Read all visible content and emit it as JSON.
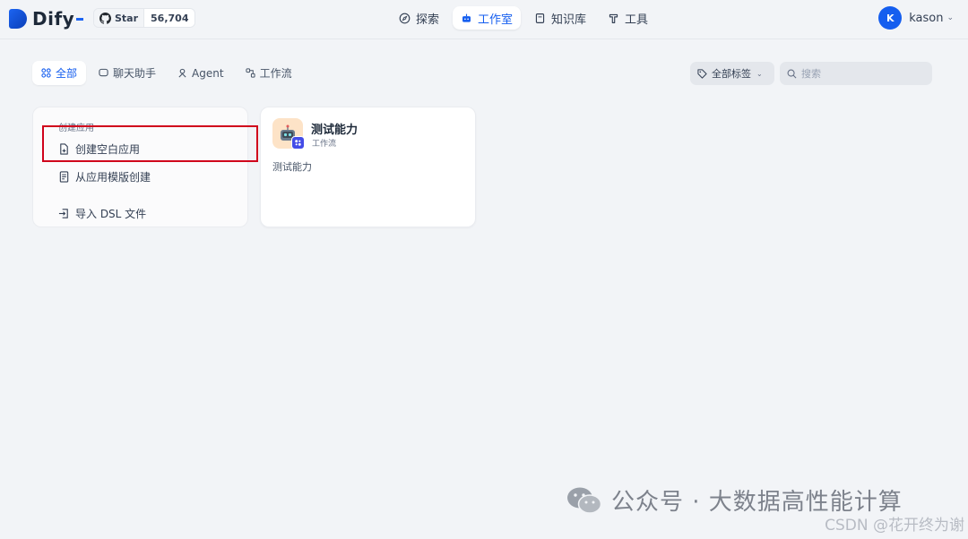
{
  "header": {
    "logo_text": "Dify",
    "github": {
      "star_label": "Star",
      "star_count": "56,704"
    },
    "nav": [
      {
        "label": "探索",
        "icon": "compass-icon",
        "active": false
      },
      {
        "label": "工作室",
        "icon": "robot-icon",
        "active": true
      },
      {
        "label": "知识库",
        "icon": "book-icon",
        "active": false
      },
      {
        "label": "工具",
        "icon": "hammer-icon",
        "active": false
      }
    ],
    "user": {
      "avatar_letter": "K",
      "name": "kason"
    }
  },
  "filters": {
    "tabs": [
      {
        "label": "全部",
        "active": true
      },
      {
        "label": "聊天助手",
        "active": false
      },
      {
        "label": "Agent",
        "active": false
      },
      {
        "label": "工作流",
        "active": false
      }
    ],
    "tag_filter_label": "全部标签",
    "search_placeholder": "搜索"
  },
  "create_card": {
    "title": "创建应用",
    "items": [
      {
        "label": "创建空白应用",
        "icon": "file-plus-icon"
      },
      {
        "label": "从应用模版创建",
        "icon": "template-icon"
      },
      {
        "label": "导入 DSL 文件",
        "icon": "import-icon"
      }
    ]
  },
  "apps": [
    {
      "name": "测试能力",
      "type": "工作流",
      "description": "测试能力",
      "icon_bg": "#fde3c7",
      "badge_color": "#444ce7"
    }
  ],
  "watermark": {
    "main": "公众号 · 大数据高性能计算",
    "sub": "CSDN @花开终为谢"
  },
  "colors": {
    "accent": "#155eef",
    "highlight": "#d0021b"
  }
}
